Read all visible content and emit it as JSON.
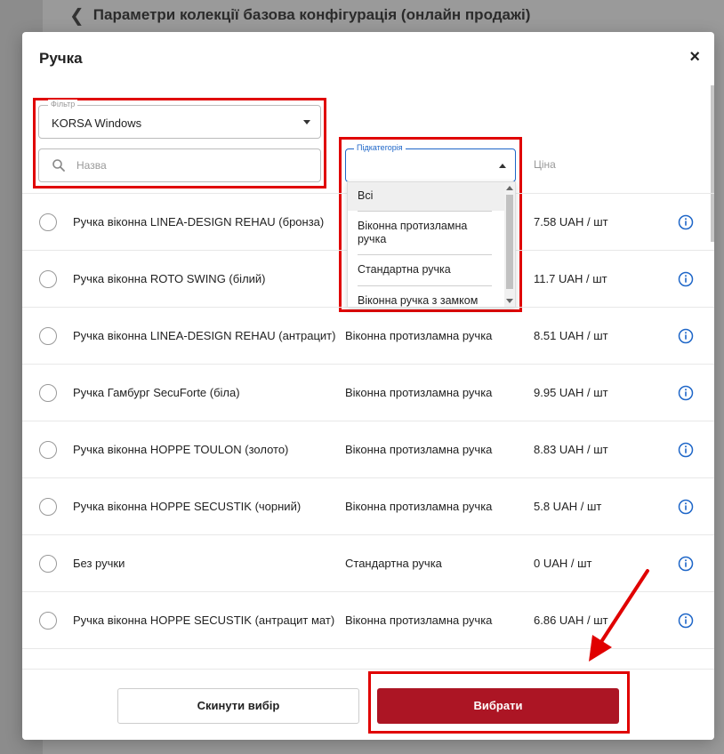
{
  "background": {
    "page_title": "Параметри колекції базова конфігурація (онлайн продажі)"
  },
  "modal": {
    "title": "Ручка",
    "close_symbol": "×"
  },
  "filters": {
    "filter_legend": "Фільтр",
    "filter_value": "KORSA Windows",
    "search_placeholder": "Назва",
    "subcategory_legend": "Підкатегорія",
    "subcategory_value": "",
    "price_header": "Ціна"
  },
  "subcategory_dropdown": {
    "options": [
      "Всі",
      "Віконна протизламна ручка",
      "Стандартна ручка",
      "Віконна ручка з замком"
    ],
    "selected": "Всі"
  },
  "table": {
    "rows": [
      {
        "name": "Ручка віконна LINEA-DESIGN REHAU (бронза)",
        "subcategory": "",
        "price": "7.58 UAH / шт"
      },
      {
        "name": "Ручка віконна ROTO SWING (білий)",
        "subcategory": "",
        "price": "11.7 UAH / шт"
      },
      {
        "name": "Ручка віконна LINEA-DESIGN REHAU (антрацит)",
        "subcategory": "Віконна протизламна ручка",
        "price": "8.51 UAH / шт"
      },
      {
        "name": "Ручка Гамбург SecuForte (біла)",
        "subcategory": "Віконна протизламна ручка",
        "price": "9.95 UAH / шт"
      },
      {
        "name": "Ручка віконна HOPPE TOULON (золото)",
        "subcategory": "Віконна протизламна ручка",
        "price": "8.83 UAH / шт"
      },
      {
        "name": "Ручка віконна HOPPE SECUSTIK (чорний)",
        "subcategory": "Віконна протизламна ручка",
        "price": "5.8 UAH / шт"
      },
      {
        "name": "Без ручки",
        "subcategory": "Стандартна ручка",
        "price": "0 UAH / шт"
      },
      {
        "name": "Ручка віконна HOPPE SECUSTIK (антрацит мат)",
        "subcategory": "Віконна протизламна ручка",
        "price": "6.86 UAH / шт"
      }
    ]
  },
  "footer": {
    "reset_label": "Скинути вибір",
    "select_label": "Вибрати"
  },
  "colors": {
    "accent": "#ac1524",
    "highlight": "#e00000",
    "info_icon": "#1e66c8"
  }
}
